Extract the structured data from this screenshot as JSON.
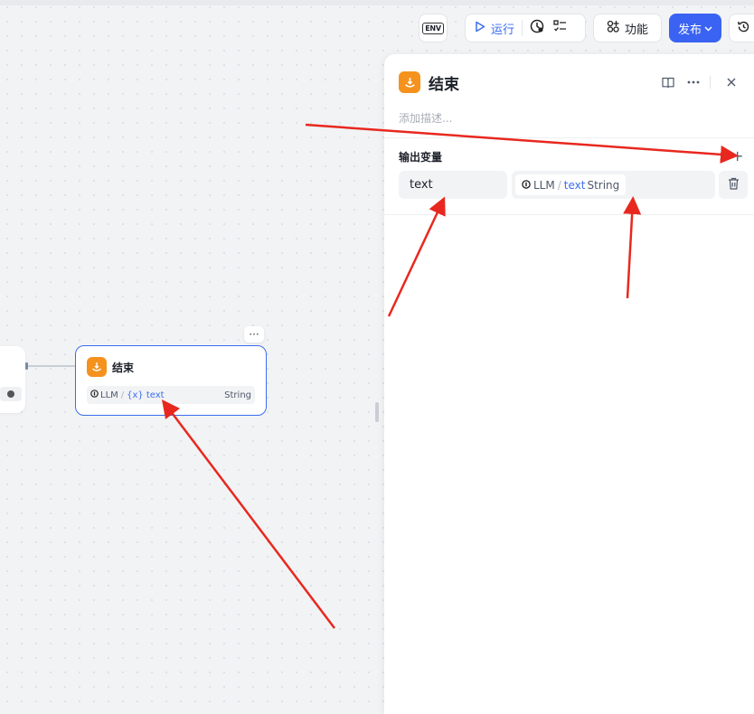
{
  "toolbar": {
    "env_label": "ENV",
    "run_label": "运行",
    "feature_label": "功能",
    "publish_label": "发布",
    "publish_chevron": "⌄"
  },
  "canvas": {
    "more_label": "···",
    "end_node": {
      "title": "结束",
      "var_source": "LLM",
      "var_prefix": "{x}",
      "var_name": "text",
      "var_type": "String"
    }
  },
  "panel": {
    "title": "结束",
    "description_placeholder": "添加描述...",
    "section_title": "输出变量",
    "add_label": "+",
    "output": {
      "name": "text",
      "source": "LLM",
      "separator": "/",
      "var_name": "text",
      "var_type": "String"
    }
  },
  "colors": {
    "accent": "#3a6df0",
    "node_icon": "#f5921e",
    "annotation_arrow": "#e8281e"
  }
}
